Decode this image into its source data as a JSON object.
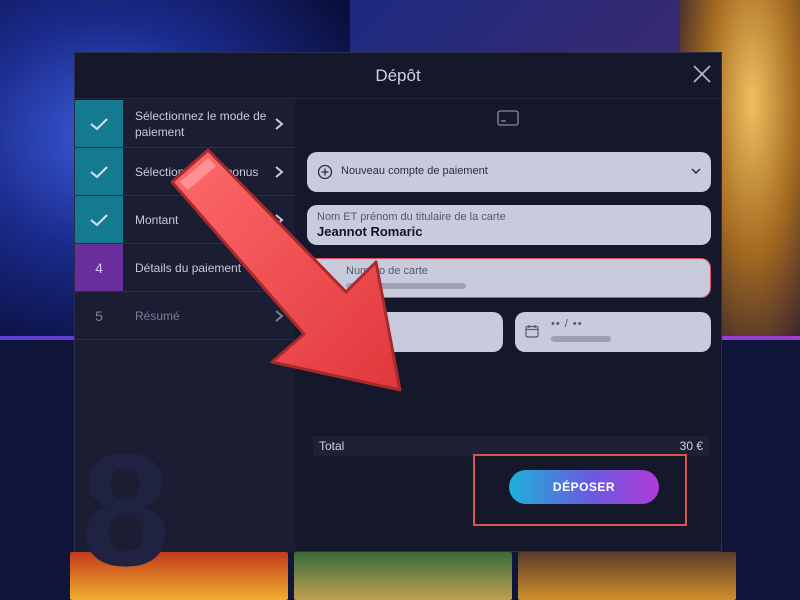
{
  "modal": {
    "title": "Dépôt"
  },
  "steps": [
    {
      "marker": "✓",
      "label": "Sélectionnez le mode de paiement",
      "state": "done"
    },
    {
      "marker": "✓",
      "label": "Sélectionnez les bonus",
      "state": "done"
    },
    {
      "marker": "✓",
      "label": "Montant",
      "state": "done"
    },
    {
      "marker": "4",
      "label": "Détails du paiement",
      "state": "active"
    },
    {
      "marker": "5",
      "label": "Résumé",
      "state": "pending"
    }
  ],
  "form": {
    "account_select": "Nouveau compte de paiement",
    "cardholder_label": "Nom ET prénom du titulaire de la carte",
    "cardholder_value": "Jeannot Romaric",
    "card_number_label": "Numéro de carte",
    "expiry_mask": "•• / ••"
  },
  "total": {
    "label": "Total",
    "amount": "30 €"
  },
  "submit": {
    "label": "DÉPOSER"
  },
  "icons": {
    "close": "close-icon",
    "check": "check-icon",
    "chevron": "chevron-right-icon",
    "card": "credit-card-icon",
    "plus": "plus-circle-icon",
    "calendar": "calendar-icon"
  },
  "colors": {
    "accent_gradient_start": "#1fb0d8",
    "accent_gradient_end": "#b13ad8",
    "done_step": "#137a8f",
    "active_step": "#6a2e9c",
    "highlight_red": "#d9534f"
  }
}
